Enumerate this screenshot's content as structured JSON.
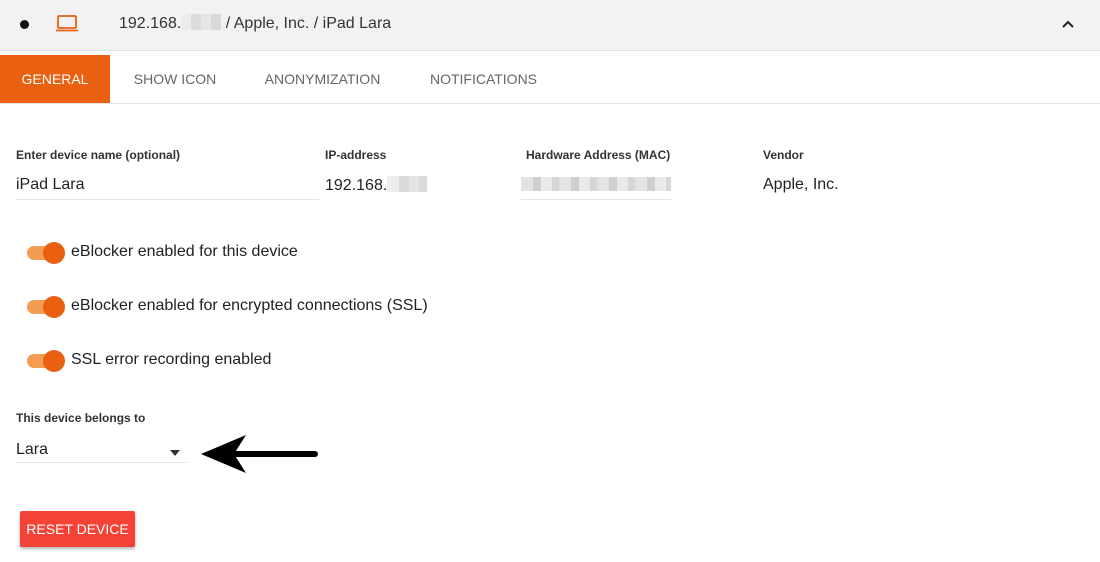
{
  "header": {
    "ip_prefix": "192.168.",
    "title_rest": "/ Apple, Inc. / iPad Lara"
  },
  "tabs": [
    {
      "label": "GENERAL",
      "active": true
    },
    {
      "label": "SHOW ICON",
      "active": false
    },
    {
      "label": "ANONYMIZATION",
      "active": false
    },
    {
      "label": "NOTIFICATIONS",
      "active": false
    }
  ],
  "fields": {
    "device_name": {
      "label": "Enter device name (optional)",
      "value": "iPad Lara"
    },
    "ip": {
      "label": "IP-address",
      "value": "192.168."
    },
    "mac": {
      "label": "Hardware Address (MAC)"
    },
    "vendor": {
      "label": "Vendor",
      "value": "Apple, Inc."
    }
  },
  "toggles": [
    {
      "label": "eBlocker enabled for this device",
      "on": true
    },
    {
      "label": "eBlocker enabled for encrypted connections (SSL)",
      "on": true
    },
    {
      "label": "SSL error recording enabled",
      "on": true
    }
  ],
  "owner": {
    "label": "This device belongs to",
    "selected": "Lara"
  },
  "reset_button": {
    "label": "RESET DEVICE"
  },
  "colors": {
    "accent": "#e86010",
    "toggle_track": "#f29d52",
    "danger": "#f44336"
  },
  "icons": [
    "status-dot",
    "laptop-icon",
    "chevron-up-icon",
    "caret-down-icon",
    "left-arrow-icon"
  ]
}
